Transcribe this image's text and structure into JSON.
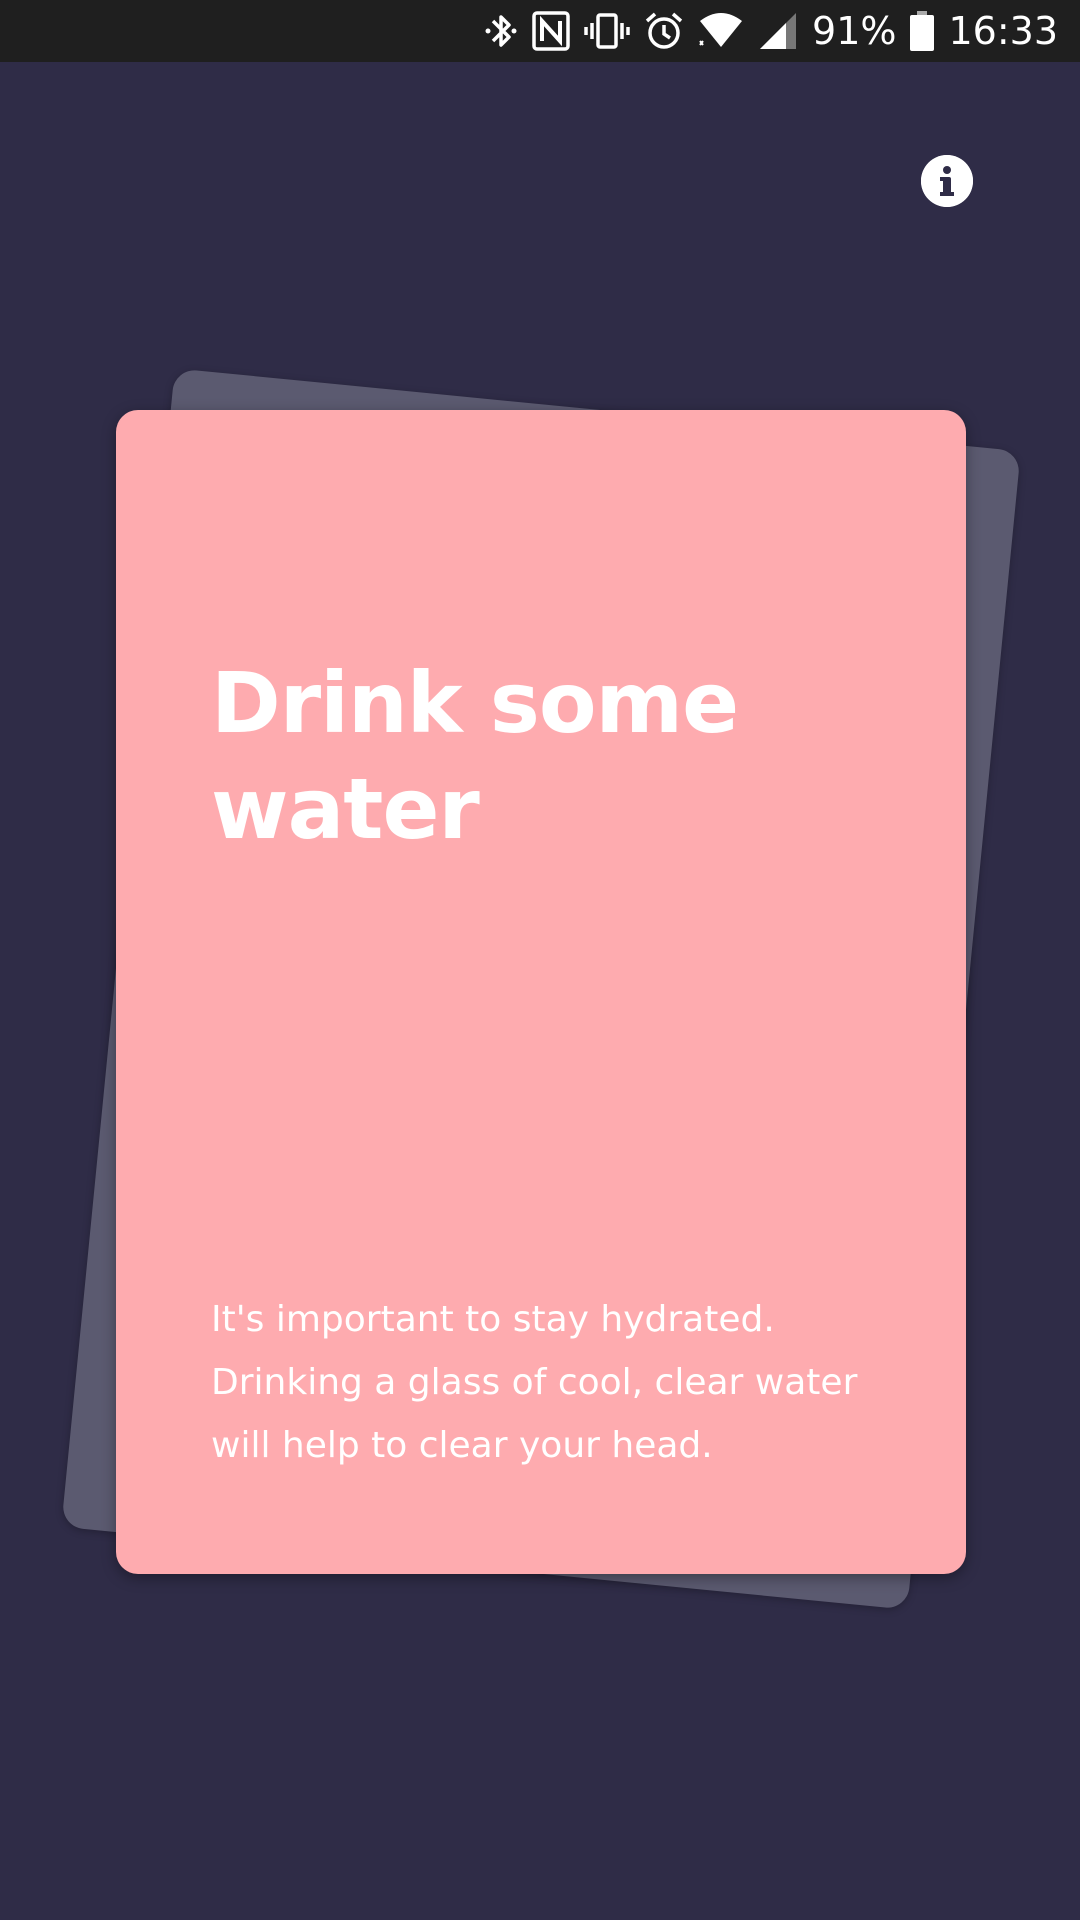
{
  "status_bar": {
    "battery_percent": "91%",
    "time": "16:33",
    "icons": [
      "bluetooth-icon",
      "nfc-icon",
      "vibrate-icon",
      "alarm-icon",
      "wifi-icon",
      "cell-signal-icon",
      "battery-icon"
    ]
  },
  "header": {
    "info_icon": "info-icon"
  },
  "card": {
    "title": "Drink some water",
    "body": "It's important to stay hydrated. Drinking a glass of cool, clear water will help to clear your head."
  },
  "colors": {
    "background": "#2f2c47",
    "card_front": "#feabaf",
    "card_back": "#5b5a70",
    "status_bar": "#1f1f1f",
    "text": "#ffffff"
  }
}
